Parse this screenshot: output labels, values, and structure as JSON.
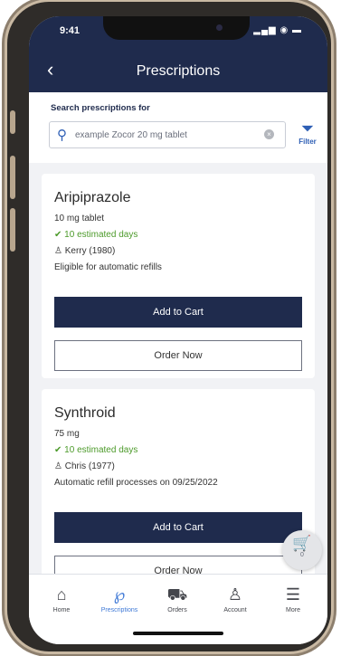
{
  "status_bar": {
    "time": "9:41",
    "icons": "▂▄▆ ◉ ▬"
  },
  "header": {
    "back_glyph": "‹",
    "title": "Prescriptions"
  },
  "search": {
    "label": "Search prescriptions for",
    "placeholder": "example Zocor 20 mg tablet",
    "clear_glyph": "×",
    "filter_label": "Filter"
  },
  "prescriptions": [
    {
      "name": "Aripiprazole",
      "dosage": "10 mg tablet",
      "supply": "10 estimated days",
      "patient": "Kerry (1980)",
      "refill_info": "Eligible for automatic refills",
      "add_label": "Add to Cart",
      "order_label": "Order Now"
    },
    {
      "name": "Synthroid",
      "dosage": "75 mg",
      "supply": "10 estimated days",
      "patient": "Chris (1977)",
      "refill_info": "Automatic refill processes on 09/25/2022",
      "add_label": "Add to Cart",
      "order_label": "Order Now"
    }
  ],
  "cart": {
    "count": "0"
  },
  "tabs": [
    {
      "label": "Home",
      "icon": "home-icon",
      "glyph": "⌂"
    },
    {
      "label": "Prescriptions",
      "icon": "pill-icon",
      "glyph": "℘"
    },
    {
      "label": "Orders",
      "icon": "truck-icon",
      "glyph": "⛟"
    },
    {
      "label": "Account",
      "icon": "person-icon",
      "glyph": "♙"
    },
    {
      "label": "More",
      "icon": "menu-icon",
      "glyph": "☰"
    }
  ],
  "colors": {
    "navy": "#1f2b4d",
    "accent_blue": "#3f79d6",
    "green": "#4c9a2a"
  }
}
